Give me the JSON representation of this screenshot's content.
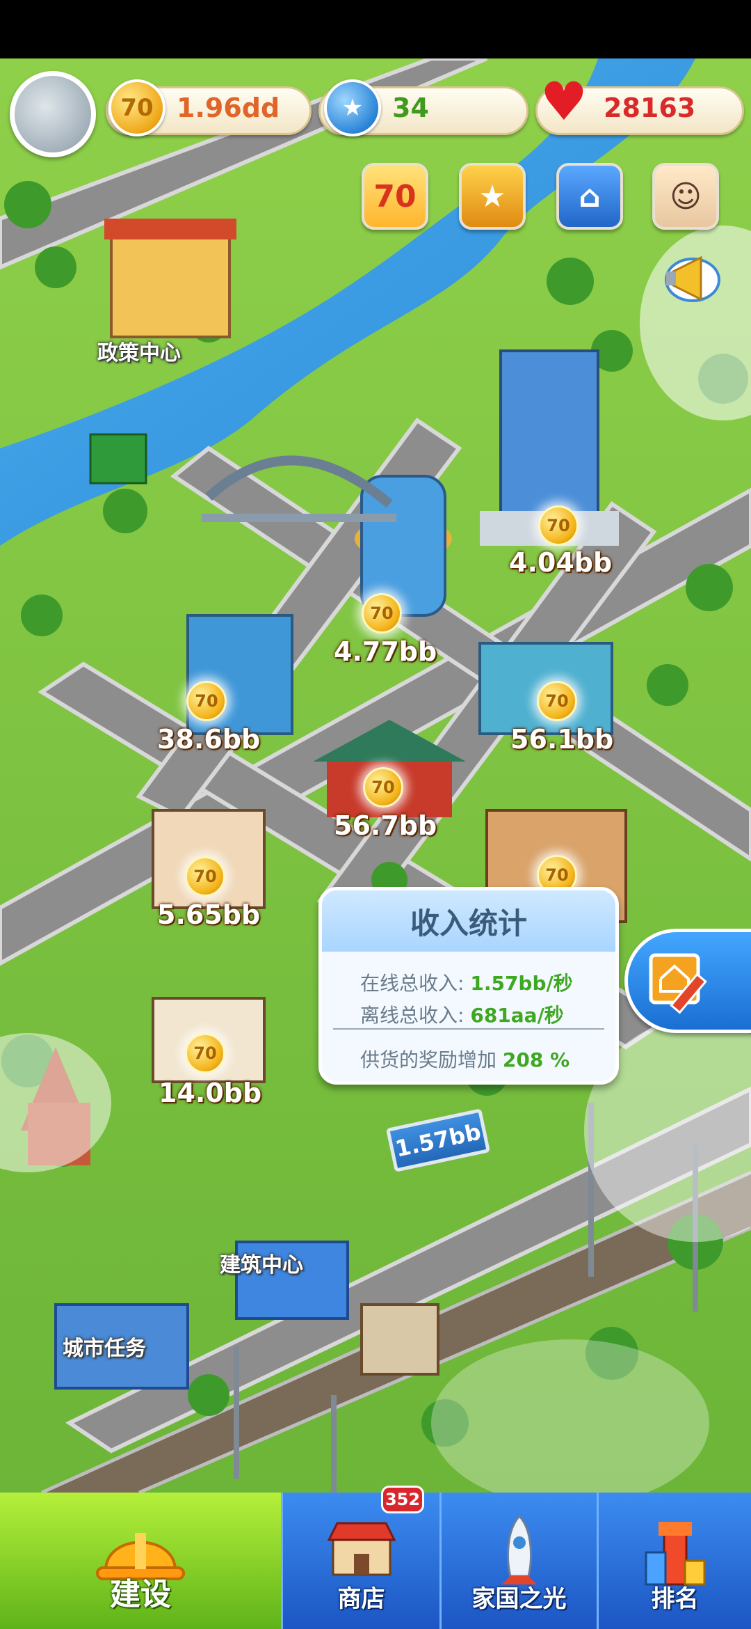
{
  "resources": {
    "coins": "1.96dd",
    "gems": "34",
    "hearts": "28163"
  },
  "icons": {
    "coin_glyph": "70",
    "event_1_glyph": "70"
  },
  "buildings": [
    {
      "id": "policy",
      "label": "政策中心"
    },
    {
      "id": "construction",
      "label": "建筑中心"
    },
    {
      "id": "missions",
      "label": "城市任务"
    }
  ],
  "incomes": [
    {
      "id": "i1",
      "value": "4.04bb"
    },
    {
      "id": "i2",
      "value": "4.77bb"
    },
    {
      "id": "i3",
      "value": "38.6bb"
    },
    {
      "id": "i4",
      "value": "56.1bb"
    },
    {
      "id": "i5",
      "value": "56.7bb"
    },
    {
      "id": "i6",
      "value": "5.65bb"
    },
    {
      "id": "i7",
      "value": "14.0bb"
    }
  ],
  "stats": {
    "title": "收入统计",
    "online_label": "在线总收入:",
    "online_value": "1.57bb/秒",
    "offline_label": "离线总收入:",
    "offline_value": "681aa/秒",
    "bonus_label": "供货的奖励增加",
    "bonus_value": "208 %"
  },
  "billboard": "1.57bb",
  "nav": {
    "build": "建设",
    "shop": "商店",
    "shop_badge": "352",
    "glory": "家国之光",
    "rank": "排名"
  },
  "colors": {
    "income_green": "#3fa822",
    "nav_build": "#7fcf22",
    "nav_blue": "#2a6fe0",
    "heart": "#e21d25"
  }
}
